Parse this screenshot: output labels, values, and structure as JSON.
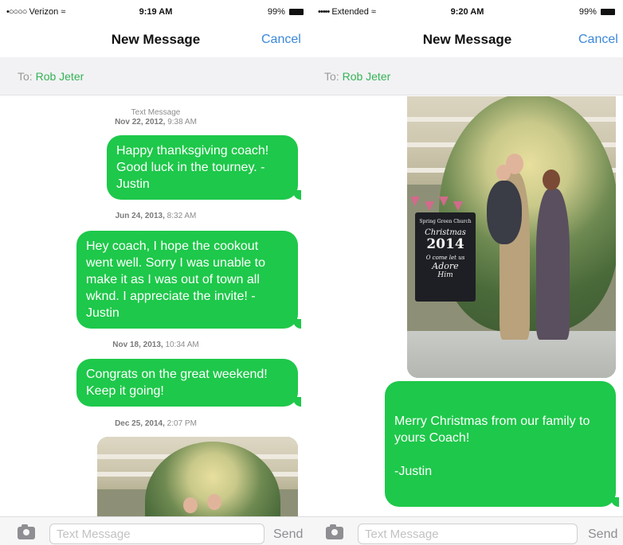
{
  "left": {
    "status": {
      "carrier": "Verizon",
      "signal": "•○○○○",
      "time": "9:19 AM",
      "battery": "99%"
    },
    "nav": {
      "title": "New Message",
      "cancel": "Cancel"
    },
    "to": {
      "label": "To:",
      "name": "Rob Jeter"
    },
    "messages": [
      {
        "header": "Text Message",
        "date": "Nov 22, 2012,",
        "time": "9:38 AM",
        "text": "Happy thanksgiving coach! Good luck in the tourney.  - Justin"
      },
      {
        "date": "Jun 24, 2013,",
        "time": "8:32 AM",
        "text": "Hey coach, I hope the cookout went well.  Sorry I was unable to make it as I was out of town all wknd.  I appreciate the invite! - Justin"
      },
      {
        "date": "Nov 18, 2013,",
        "time": "10:34 AM",
        "text": "Congrats on the great weekend! Keep it going!"
      },
      {
        "date": "Dec 25, 2014,",
        "time": "2:07 PM"
      }
    ],
    "input": {
      "placeholder": "Text Message",
      "send": "Send"
    }
  },
  "right": {
    "status": {
      "carrier": "Extended",
      "signal": "•••••",
      "time": "9:20 AM",
      "battery": "99%"
    },
    "nav": {
      "title": "New Message",
      "cancel": "Cancel"
    },
    "to": {
      "label": "To:",
      "name": "Rob Jeter"
    },
    "photo_board": {
      "line1": "Spring Green Church",
      "line2": "Christmas",
      "line3": "2014",
      "line4": "O come let us",
      "line5": "Adore",
      "line6": "Him"
    },
    "message": {
      "line1": "Merry Christmas from our family to yours Coach!",
      "line2": "-Justin"
    },
    "input": {
      "placeholder": "Text Message",
      "send": "Send"
    }
  },
  "colors": {
    "bubble": "#1ec84a",
    "link": "#3b88d8",
    "recipient": "#34b356"
  }
}
